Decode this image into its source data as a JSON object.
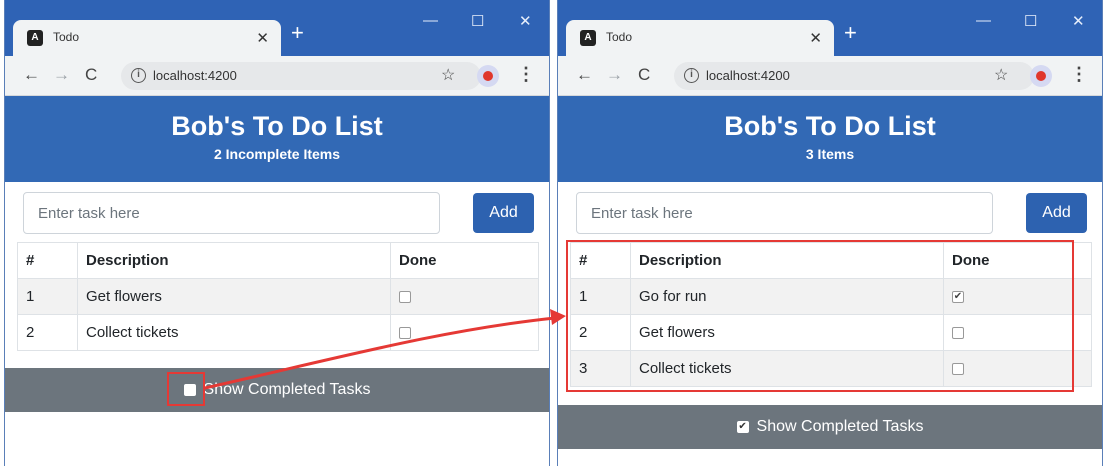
{
  "windows": [
    {
      "tab_title": "Todo",
      "url": "localhost:4200",
      "app_title": "Bob's To Do List",
      "subtitle": "2 Incomplete Items",
      "input_placeholder": "Enter task here",
      "add_label": "Add",
      "columns": [
        "#",
        "Description",
        "Done"
      ],
      "rows": [
        {
          "num": "1",
          "description": "Get flowers",
          "done": false
        },
        {
          "num": "2",
          "description": "Collect tickets",
          "done": false
        }
      ],
      "show_completed_label": "Show Completed Tasks",
      "show_completed_checked": false
    },
    {
      "tab_title": "Todo",
      "url": "localhost:4200",
      "app_title": "Bob's To Do List",
      "subtitle": "3 Items",
      "input_placeholder": "Enter task here",
      "add_label": "Add",
      "columns": [
        "#",
        "Description",
        "Done"
      ],
      "rows": [
        {
          "num": "1",
          "description": "Go for run",
          "done": true
        },
        {
          "num": "2",
          "description": "Get flowers",
          "done": false
        },
        {
          "num": "3",
          "description": "Collect tickets",
          "done": false
        }
      ],
      "show_completed_label": "Show Completed Tasks",
      "show_completed_checked": true
    }
  ],
  "browser": {
    "back_icon": "arrow-left-icon",
    "forward_icon": "arrow-right-icon",
    "reload_icon": "reload-icon",
    "star_icon": "bookmark-star-icon",
    "menu_icon": "menu-dots-icon"
  },
  "colors": {
    "titlebar": "#2f63b5",
    "header": "#3269b5",
    "add_button": "#2d62b0",
    "footer": "#6c757d",
    "annotation": "#e53935"
  }
}
